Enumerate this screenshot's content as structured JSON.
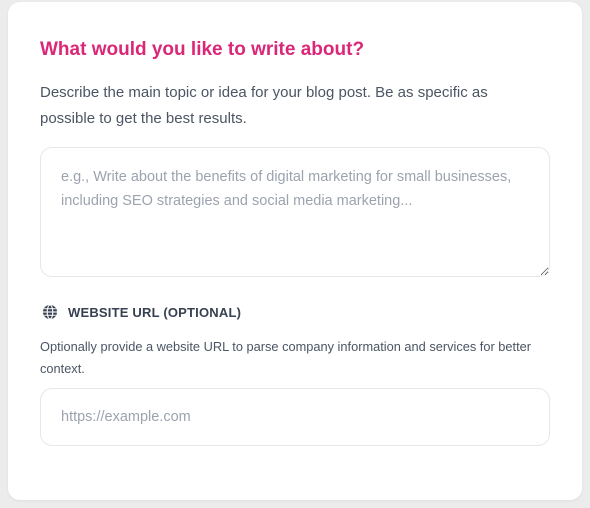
{
  "form": {
    "title": "What would you like to write about?",
    "description": "Describe the main topic or idea for your blog post. Be as specific as possible to get the best results.",
    "topic_input": {
      "value": "",
      "placeholder": "e.g., Write about the benefits of digital marketing for small businesses, including SEO strategies and social media marketing..."
    },
    "website": {
      "icon": "globe-icon",
      "label": "WEBSITE URL (OPTIONAL)",
      "helper": "Optionally provide a website URL to parse company information and services for better context.",
      "input": {
        "value": "",
        "placeholder": "https://example.com"
      }
    }
  },
  "colors": {
    "title": "#db2777",
    "label": "#374151",
    "placeholder": "#9ca3af",
    "border": "#e5e7eb"
  }
}
